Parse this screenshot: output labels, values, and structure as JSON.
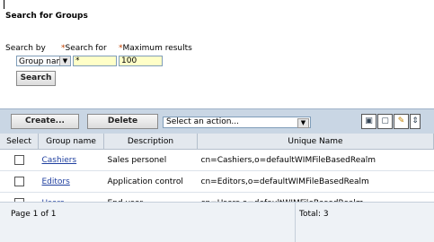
{
  "page": {
    "title": "Search for Groups"
  },
  "search": {
    "by_label": "Search by",
    "for_label": "Search for",
    "max_label": "Maximum results",
    "required_mark": "*",
    "by_value": "Group name",
    "for_value": "*",
    "max_value": "100",
    "search_button": "Search"
  },
  "toolbar": {
    "create_button": "Create...",
    "delete_button": "Delete",
    "action_select": "Select an action...",
    "icons": [
      "select-all-icon",
      "deselect-all-icon",
      "edit-filter-icon",
      "collapse-icon"
    ]
  },
  "table": {
    "headers": [
      "Select",
      "Group name",
      "Description",
      "Unique Name"
    ],
    "rows": [
      {
        "name": "Cashiers",
        "description": "Sales personel",
        "unique": "cn=Cashiers,o=defaultWIMFileBasedRealm"
      },
      {
        "name": "Editors",
        "description": "Application control",
        "unique": "cn=Editors,o=defaultWIMFileBasedRealm"
      },
      {
        "name": "Users",
        "description": "End user",
        "unique": "cn=Users,o=defaultWIMFileBasedRealm"
      }
    ]
  },
  "footer": {
    "page_text": "Page 1 of 1",
    "total_text": "Total: 3"
  }
}
